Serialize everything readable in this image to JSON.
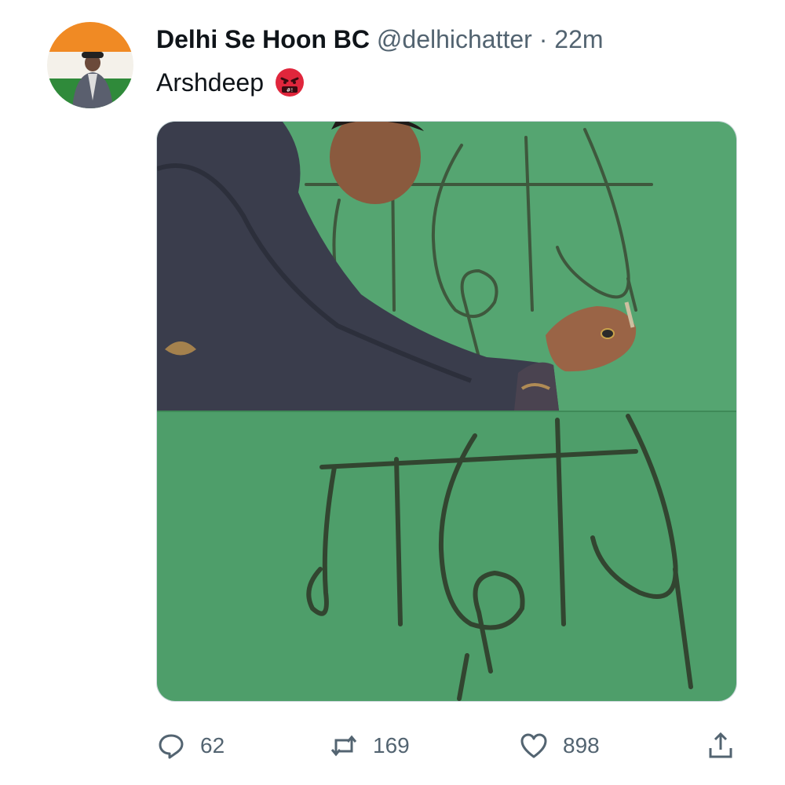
{
  "tweet": {
    "display_name": "Delhi Se Hoon BC",
    "handle": "@delhichatter",
    "separator": "·",
    "time": "22m",
    "text": "Arshdeep",
    "text_emoji": "angry-face-with-symbols-icon",
    "avatar_icon": "profile-avatar-icon"
  },
  "media": {
    "description_icon": "photo-man-writing-on-green-wall",
    "panels": 2
  },
  "actions": {
    "reply_count": "62",
    "retweet_count": "169",
    "like_count": "898",
    "reply_icon": "reply-icon",
    "retweet_icon": "retweet-icon",
    "like_icon": "heart-icon",
    "share_icon": "share-icon"
  },
  "colors": {
    "muted": "#536471",
    "wall": "#4ea06d",
    "emoji_red": "#e0263c"
  }
}
